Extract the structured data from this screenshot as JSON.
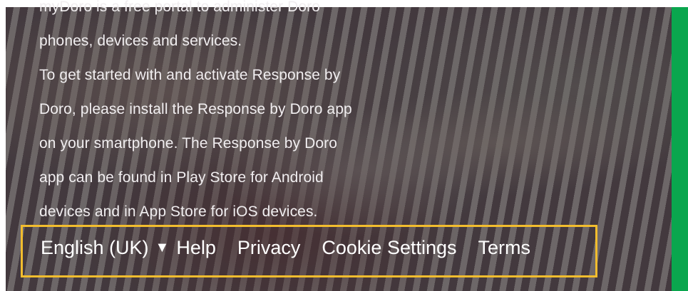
{
  "intro": {
    "lines": [
      "myDoro is a free portal to administer Doro",
      "phones, devices and services.",
      "To get started with and activate Response by",
      "Doro, please install the Response by Doro app",
      "on your smartphone. The Response by Doro",
      "app can be found in Play Store for Android",
      "devices and in App Store for iOS devices."
    ]
  },
  "footer": {
    "language": "English (UK)",
    "language_caret_icon": "caret-down-icon",
    "links": [
      "Help",
      "Privacy",
      "Cookie Settings",
      "Terms"
    ]
  },
  "colors": {
    "accent_green": "#0aa64e",
    "highlight_yellow": "#f2bd2e",
    "text_light": "#ffffff"
  }
}
